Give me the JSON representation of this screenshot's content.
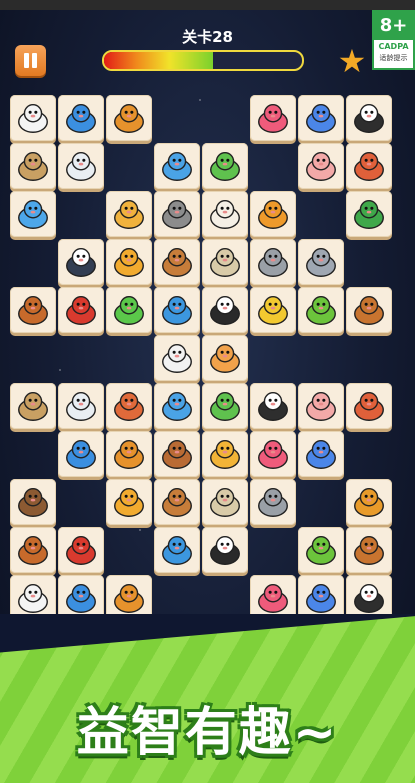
{
  "header": {
    "level_title": "关卡28",
    "progress": 0.55
  },
  "rating": {
    "age": "8+",
    "org": "CADPA",
    "tip": "适龄提示"
  },
  "slogan": "益智有趣~",
  "animal_colors": {
    "bear-white": "#f4f4f4",
    "shark": "#3b8fe0",
    "ladybug": "#e6922c",
    "octopus": "#ef5b7b",
    "rhino": "#4b86e8",
    "bee": "#2e2e2e",
    "owl": "#c9a063",
    "seal": "#e9eef2",
    "dolphin": "#4aa3e6",
    "dino": "#5fc24e",
    "pig": "#f3a9a8",
    "hedgehog": "#e0603a",
    "fish": "#4da7ea",
    "snail": "#f0b23d",
    "koala": "#8c8c8c",
    "sheep": "#f5f0e6",
    "lion": "#ee9a2b",
    "snake": "#3fa84a",
    "penguin": "#333e52",
    "tiger": "#f2ab2f",
    "deer": "#c77d3a",
    "monkey": "#d9cba8",
    "hippo": "#9aa0a7",
    "elephant": "#9fa7b2",
    "horse": "#c76a2b",
    "gorilla": "#d93a2e",
    "frog": "#5bc84a",
    "whale": "#3c97df",
    "panda": "#2a2a2a",
    "leopard": "#f2c930",
    "parrot": "#6cc43c",
    "ox": "#c8742f",
    "rabbit": "#f2f2f2",
    "cat": "#f2a24a",
    "squirrel": "#e06a3a",
    "raccoon": "#b96b34",
    "rooster": "#f2b437",
    "brown-bear": "#8c5a32",
    "dog": "#e89b2a"
  },
  "board": [
    {
      "r": 0,
      "c": 0,
      "a": "bear-white"
    },
    {
      "r": 0,
      "c": 1,
      "a": "shark"
    },
    {
      "r": 0,
      "c": 2,
      "a": "ladybug"
    },
    {
      "r": 0,
      "c": 5,
      "a": "octopus"
    },
    {
      "r": 0,
      "c": 6,
      "a": "rhino"
    },
    {
      "r": 0,
      "c": 7,
      "a": "bee"
    },
    {
      "r": 1,
      "c": 0,
      "a": "owl"
    },
    {
      "r": 1,
      "c": 1,
      "a": "seal"
    },
    {
      "r": 1,
      "c": 3,
      "a": "dolphin"
    },
    {
      "r": 1,
      "c": 4,
      "a": "dino"
    },
    {
      "r": 1,
      "c": 6,
      "a": "pig"
    },
    {
      "r": 1,
      "c": 7,
      "a": "hedgehog"
    },
    {
      "r": 2,
      "c": 0,
      "a": "fish"
    },
    {
      "r": 2,
      "c": 2,
      "a": "snail"
    },
    {
      "r": 2,
      "c": 3,
      "a": "koala"
    },
    {
      "r": 2,
      "c": 4,
      "a": "sheep"
    },
    {
      "r": 2,
      "c": 5,
      "a": "lion"
    },
    {
      "r": 2,
      "c": 7,
      "a": "snake"
    },
    {
      "r": 3,
      "c": 1,
      "a": "penguin"
    },
    {
      "r": 3,
      "c": 2,
      "a": "tiger"
    },
    {
      "r": 3,
      "c": 3,
      "a": "deer"
    },
    {
      "r": 3,
      "c": 4,
      "a": "monkey"
    },
    {
      "r": 3,
      "c": 5,
      "a": "hippo"
    },
    {
      "r": 3,
      "c": 6,
      "a": "elephant"
    },
    {
      "r": 4,
      "c": 0,
      "a": "horse"
    },
    {
      "r": 4,
      "c": 1,
      "a": "gorilla"
    },
    {
      "r": 4,
      "c": 2,
      "a": "frog"
    },
    {
      "r": 4,
      "c": 3,
      "a": "whale"
    },
    {
      "r": 4,
      "c": 4,
      "a": "panda"
    },
    {
      "r": 4,
      "c": 5,
      "a": "leopard"
    },
    {
      "r": 4,
      "c": 6,
      "a": "parrot"
    },
    {
      "r": 4,
      "c": 7,
      "a": "ox"
    },
    {
      "r": 5,
      "c": 3,
      "a": "rabbit"
    },
    {
      "r": 5,
      "c": 4,
      "a": "cat"
    },
    {
      "r": 6,
      "c": 0,
      "a": "owl"
    },
    {
      "r": 6,
      "c": 1,
      "a": "seal"
    },
    {
      "r": 6,
      "c": 2,
      "a": "squirrel"
    },
    {
      "r": 6,
      "c": 3,
      "a": "dolphin"
    },
    {
      "r": 6,
      "c": 4,
      "a": "dino"
    },
    {
      "r": 6,
      "c": 5,
      "a": "bee"
    },
    {
      "r": 6,
      "c": 6,
      "a": "pig"
    },
    {
      "r": 6,
      "c": 7,
      "a": "hedgehog"
    },
    {
      "r": 7,
      "c": 1,
      "a": "shark"
    },
    {
      "r": 7,
      "c": 2,
      "a": "ladybug"
    },
    {
      "r": 7,
      "c": 3,
      "a": "raccoon"
    },
    {
      "r": 7,
      "c": 4,
      "a": "rooster"
    },
    {
      "r": 7,
      "c": 5,
      "a": "octopus"
    },
    {
      "r": 7,
      "c": 6,
      "a": "rhino"
    },
    {
      "r": 8,
      "c": 0,
      "a": "brown-bear"
    },
    {
      "r": 8,
      "c": 2,
      "a": "tiger"
    },
    {
      "r": 8,
      "c": 3,
      "a": "deer"
    },
    {
      "r": 8,
      "c": 4,
      "a": "monkey"
    },
    {
      "r": 8,
      "c": 5,
      "a": "hippo"
    },
    {
      "r": 8,
      "c": 7,
      "a": "dog"
    },
    {
      "r": 9,
      "c": 0,
      "a": "horse"
    },
    {
      "r": 9,
      "c": 1,
      "a": "gorilla"
    },
    {
      "r": 9,
      "c": 3,
      "a": "whale"
    },
    {
      "r": 9,
      "c": 4,
      "a": "panda"
    },
    {
      "r": 9,
      "c": 6,
      "a": "parrot"
    },
    {
      "r": 9,
      "c": 7,
      "a": "ox"
    },
    {
      "r": 10,
      "c": 0,
      "a": "bear-white"
    },
    {
      "r": 10,
      "c": 1,
      "a": "shark"
    },
    {
      "r": 10,
      "c": 2,
      "a": "ladybug"
    },
    {
      "r": 10,
      "c": 5,
      "a": "octopus"
    },
    {
      "r": 10,
      "c": 6,
      "a": "rhino"
    },
    {
      "r": 10,
      "c": 7,
      "a": "bee"
    }
  ]
}
